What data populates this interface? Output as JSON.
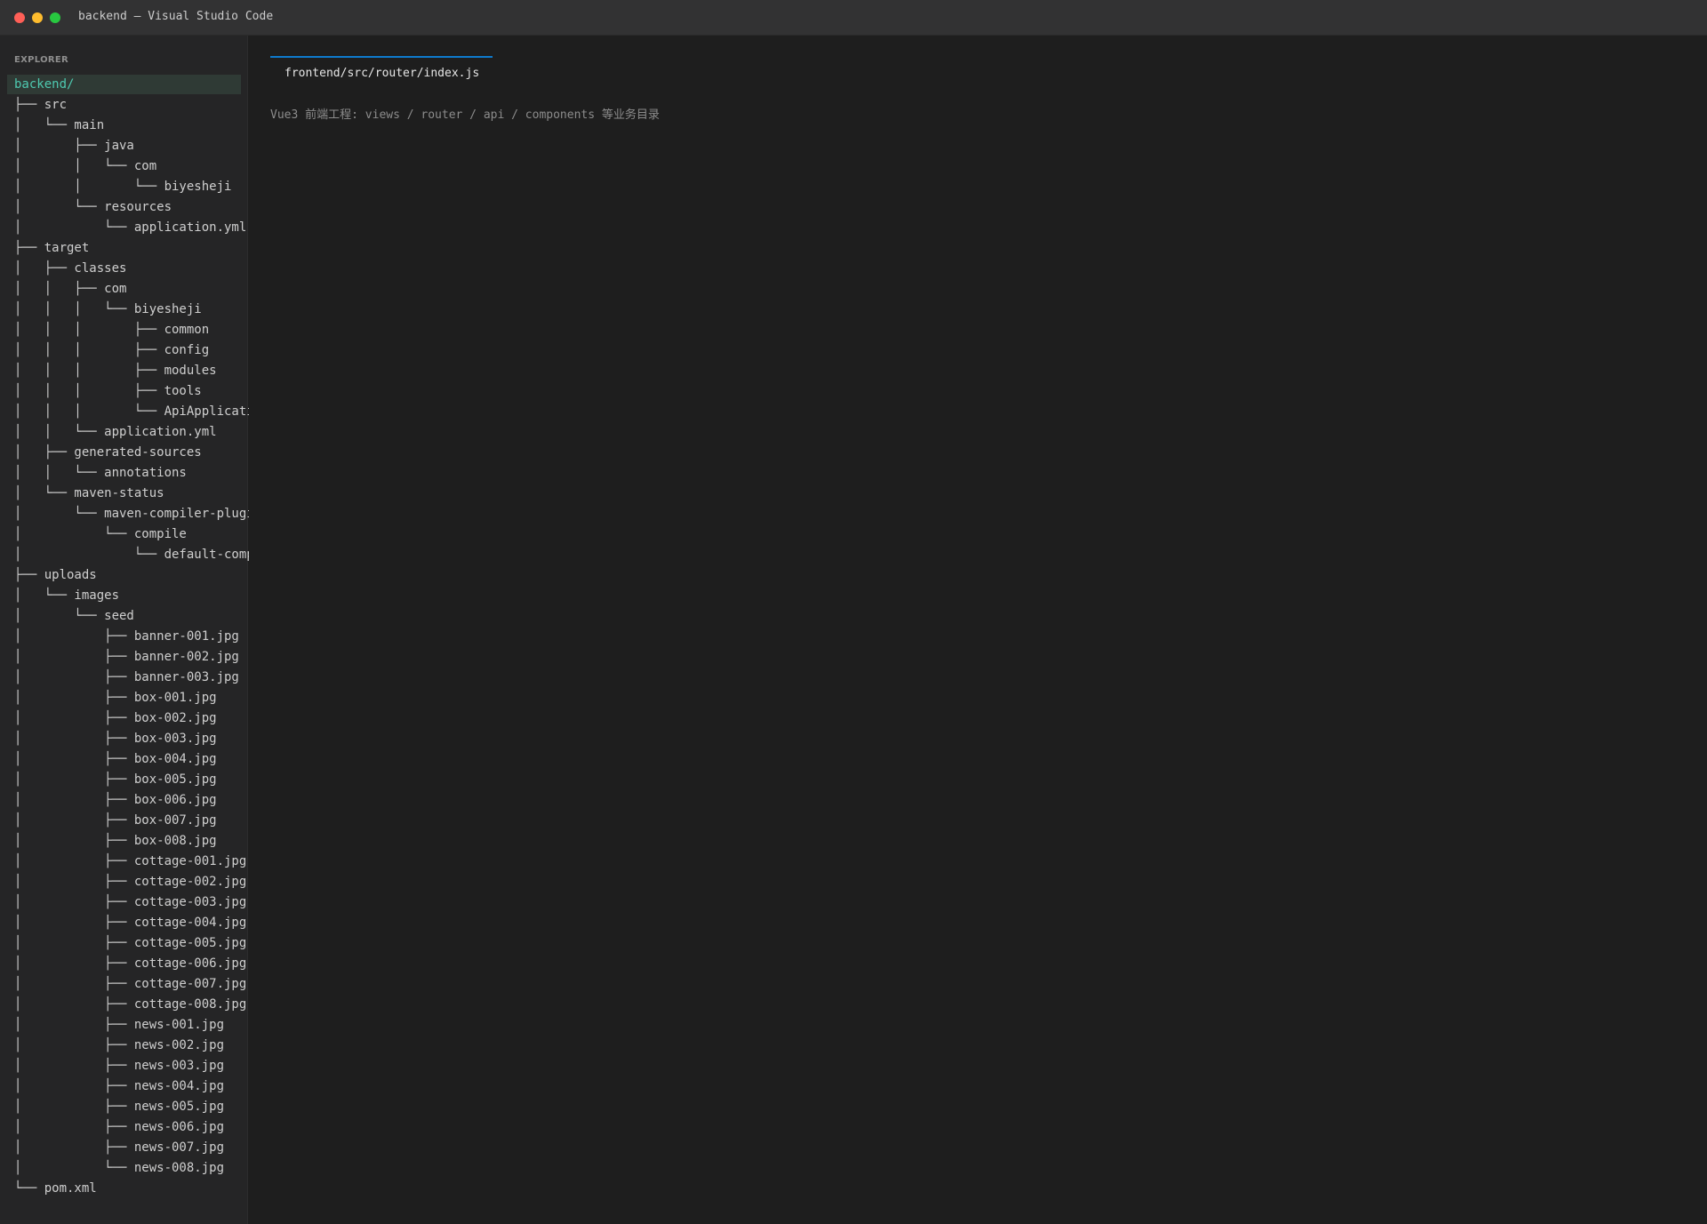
{
  "window": {
    "title": "backend — Visual Studio Code"
  },
  "sidebar": {
    "header": "EXPLORER",
    "tree": [
      "backend/",
      "├── src",
      "│   └── main",
      "│       ├── java",
      "│       │   └── com",
      "│       │       └── biyesheji",
      "│       └── resources",
      "│           └── application.yml",
      "├── target",
      "│   ├── classes",
      "│   │   ├── com",
      "│   │   │   └── biyesheji",
      "│   │   │       ├── common",
      "│   │   │       ├── config",
      "│   │   │       ├── modules",
      "│   │   │       ├── tools",
      "│   │   │       └── ApiApplication.class",
      "│   │   └── application.yml",
      "│   ├── generated-sources",
      "│   │   └── annotations",
      "│   └── maven-status",
      "│       └── maven-compiler-plugin",
      "│           └── compile",
      "│               └── default-compile",
      "├── uploads",
      "│   └── images",
      "│       └── seed",
      "│           ├── banner-001.jpg",
      "│           ├── banner-002.jpg",
      "│           ├── banner-003.jpg",
      "│           ├── box-001.jpg",
      "│           ├── box-002.jpg",
      "│           ├── box-003.jpg",
      "│           ├── box-004.jpg",
      "│           ├── box-005.jpg",
      "│           ├── box-006.jpg",
      "│           ├── box-007.jpg",
      "│           ├── box-008.jpg",
      "│           ├── cottage-001.jpg",
      "│           ├── cottage-002.jpg",
      "│           ├── cottage-003.jpg",
      "│           ├── cottage-004.jpg",
      "│           ├── cottage-005.jpg",
      "│           ├── cottage-006.jpg",
      "│           ├── cottage-007.jpg",
      "│           ├── cottage-008.jpg",
      "│           ├── news-001.jpg",
      "│           ├── news-002.jpg",
      "│           ├── news-003.jpg",
      "│           ├── news-004.jpg",
      "│           ├── news-005.jpg",
      "│           ├── news-006.jpg",
      "│           ├── news-007.jpg",
      "│           └── news-008.jpg",
      "└── pom.xml"
    ]
  },
  "editor": {
    "tab_label": "frontend/src/router/index.js",
    "note": "Vue3 前端工程: views / router / api / components 等业务目录"
  },
  "colors": {
    "accent": "#0e7acd",
    "root_label": "#4ec9b0",
    "close": "#ff5f57",
    "minimize": "#febc2e",
    "maximize": "#28c840"
  }
}
